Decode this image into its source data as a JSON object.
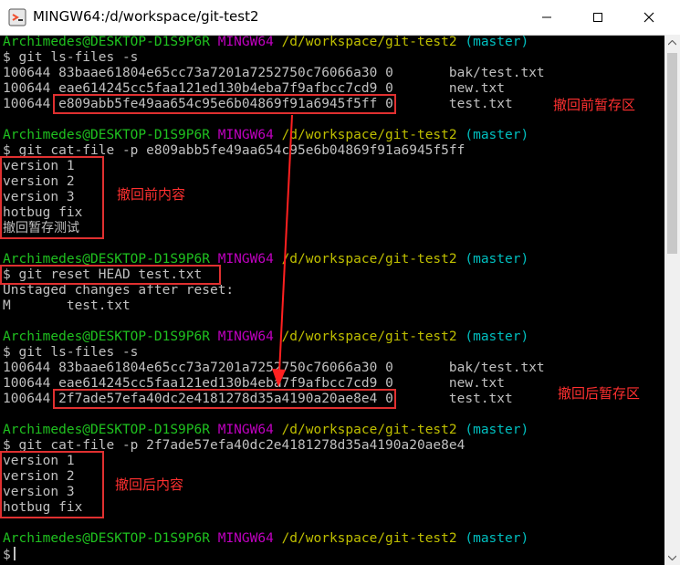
{
  "window": {
    "title": "MINGW64:/d/workspace/git-test2"
  },
  "colors": {
    "prompt_user": "#1fc11f",
    "prompt_shell": "#bf00bf",
    "prompt_path": "#bfbf00",
    "prompt_branch": "#00bfbf",
    "annotation": "#ff3030"
  },
  "prompt": {
    "user": "Archimedes@DESKTOP-D1S9P6R",
    "shell": "MINGW64",
    "path": "/d/workspace/git-test2",
    "branch": "(master)"
  },
  "commands": {
    "ls_files_1": "$ git ls-files -s",
    "cat_file_1": "$ git cat-file -p e809abb5fe49aa654c95e6b04869f91a6945f5ff",
    "reset": "$ git reset HEAD test.txt",
    "ls_files_2": "$ git ls-files -s",
    "cat_file_2": "$ git cat-file -p 2f7ade57efa40dc2e4181278d35a4190a20ae8e4",
    "final_prompt": "$"
  },
  "ls_before": [
    {
      "mode": "100644",
      "hash": "83baae61804e65cc73a7201a7252750c76066a30",
      "stage": "0",
      "file": "bak/test.txt"
    },
    {
      "mode": "100644",
      "hash": "eae614245cc5faa121ed130b4eba7f9afbcc7cd9",
      "stage": "0",
      "file": "new.txt"
    },
    {
      "mode": "100644",
      "hash": "e809abb5fe49aa654c95e6b04869f91a6945f5ff",
      "stage": "0",
      "file": "test.txt"
    }
  ],
  "content_before": [
    "version 1",
    "version 2",
    "version 3",
    "hotbug fix",
    "撤回暂存测试"
  ],
  "reset_output": [
    "Unstaged changes after reset:",
    "M       test.txt"
  ],
  "ls_after": [
    {
      "mode": "100644",
      "hash": "83baae61804e65cc73a7201a7252750c76066a30",
      "stage": "0",
      "file": "bak/test.txt"
    },
    {
      "mode": "100644",
      "hash": "eae614245cc5faa121ed130b4eba7f9afbcc7cd9",
      "stage": "0",
      "file": "new.txt"
    },
    {
      "mode": "100644",
      "hash": "2f7ade57efa40dc2e4181278d35a4190a20ae8e4",
      "stage": "0",
      "file": "test.txt"
    }
  ],
  "content_after": [
    "version 1",
    "version 2",
    "version 3",
    "hotbug fix"
  ],
  "annotations": {
    "staged_before": "撤回前暂存区",
    "content_before": "撤回前内容",
    "staged_after": "撤回后暂存区",
    "content_after": "撤回后内容"
  }
}
